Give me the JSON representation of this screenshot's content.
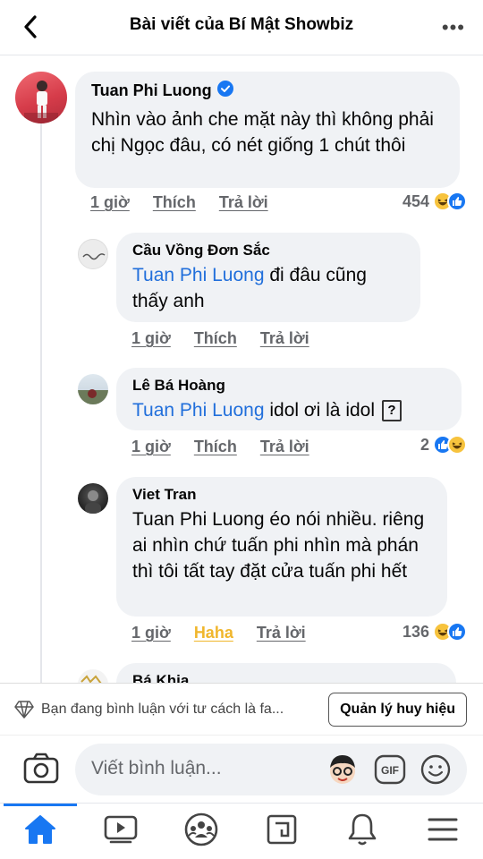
{
  "header": {
    "title": "Bài viết của Bí Mật Showbiz"
  },
  "comments": [
    {
      "author": "Tuan Phi Luong",
      "verified": true,
      "text": "Nhìn vào ảnh che mặt này thì không phải chị Ngọc đâu, có nét giống 1 chút thôi",
      "time": "1 giờ",
      "like": "Thích",
      "reply": "Trả lời",
      "reaction_count": "454"
    },
    {
      "author": "Cầu Vồng Đơn Sắc",
      "mention": "Tuan Phi Luong",
      "text": " đi đâu cũng thấy anh",
      "time": "1 giờ",
      "like": "Thích",
      "reply": "Trả lời"
    },
    {
      "author": "Lê Bá Hoàng",
      "mention": "Tuan Phi Luong",
      "text": " idol ơi là idol",
      "time": "1 giờ",
      "like": "Thích",
      "reply": "Trả lời",
      "reaction_count": "2"
    },
    {
      "author": "Viet Tran",
      "text": "Tuan Phi Luong éo nói nhiều. riêng ai nhìn chứ tuấn phi nhìn mà phán thì tôi tất tay đặt cửa tuấn phi hết",
      "time": "1 giờ",
      "like": "Haha",
      "reply": "Trả lời",
      "reaction_count": "136"
    },
    {
      "author": "Bá Khia"
    }
  ],
  "notice": {
    "text": "Bạn đang bình luận với tư cách là fa...",
    "button": "Quản lý huy hiệu"
  },
  "composer": {
    "placeholder": "Viết bình luận..."
  },
  "colors": {
    "accent": "#1877f2",
    "mention": "#216fdb",
    "haha": "#f0b62c"
  }
}
